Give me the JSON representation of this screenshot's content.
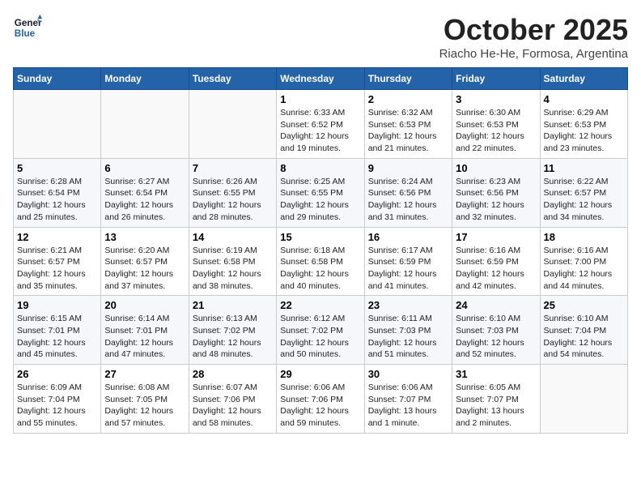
{
  "header": {
    "logo_general": "General",
    "logo_blue": "Blue",
    "month_title": "October 2025",
    "location": "Riacho He-He, Formosa, Argentina"
  },
  "weekdays": [
    "Sunday",
    "Monday",
    "Tuesday",
    "Wednesday",
    "Thursday",
    "Friday",
    "Saturday"
  ],
  "weeks": [
    [
      {
        "day": "",
        "info": ""
      },
      {
        "day": "",
        "info": ""
      },
      {
        "day": "",
        "info": ""
      },
      {
        "day": "1",
        "info": "Sunrise: 6:33 AM\nSunset: 6:52 PM\nDaylight: 12 hours\nand 19 minutes."
      },
      {
        "day": "2",
        "info": "Sunrise: 6:32 AM\nSunset: 6:53 PM\nDaylight: 12 hours\nand 21 minutes."
      },
      {
        "day": "3",
        "info": "Sunrise: 6:30 AM\nSunset: 6:53 PM\nDaylight: 12 hours\nand 22 minutes."
      },
      {
        "day": "4",
        "info": "Sunrise: 6:29 AM\nSunset: 6:53 PM\nDaylight: 12 hours\nand 23 minutes."
      }
    ],
    [
      {
        "day": "5",
        "info": "Sunrise: 6:28 AM\nSunset: 6:54 PM\nDaylight: 12 hours\nand 25 minutes."
      },
      {
        "day": "6",
        "info": "Sunrise: 6:27 AM\nSunset: 6:54 PM\nDaylight: 12 hours\nand 26 minutes."
      },
      {
        "day": "7",
        "info": "Sunrise: 6:26 AM\nSunset: 6:55 PM\nDaylight: 12 hours\nand 28 minutes."
      },
      {
        "day": "8",
        "info": "Sunrise: 6:25 AM\nSunset: 6:55 PM\nDaylight: 12 hours\nand 29 minutes."
      },
      {
        "day": "9",
        "info": "Sunrise: 6:24 AM\nSunset: 6:56 PM\nDaylight: 12 hours\nand 31 minutes."
      },
      {
        "day": "10",
        "info": "Sunrise: 6:23 AM\nSunset: 6:56 PM\nDaylight: 12 hours\nand 32 minutes."
      },
      {
        "day": "11",
        "info": "Sunrise: 6:22 AM\nSunset: 6:57 PM\nDaylight: 12 hours\nand 34 minutes."
      }
    ],
    [
      {
        "day": "12",
        "info": "Sunrise: 6:21 AM\nSunset: 6:57 PM\nDaylight: 12 hours\nand 35 minutes."
      },
      {
        "day": "13",
        "info": "Sunrise: 6:20 AM\nSunset: 6:57 PM\nDaylight: 12 hours\nand 37 minutes."
      },
      {
        "day": "14",
        "info": "Sunrise: 6:19 AM\nSunset: 6:58 PM\nDaylight: 12 hours\nand 38 minutes."
      },
      {
        "day": "15",
        "info": "Sunrise: 6:18 AM\nSunset: 6:58 PM\nDaylight: 12 hours\nand 40 minutes."
      },
      {
        "day": "16",
        "info": "Sunrise: 6:17 AM\nSunset: 6:59 PM\nDaylight: 12 hours\nand 41 minutes."
      },
      {
        "day": "17",
        "info": "Sunrise: 6:16 AM\nSunset: 6:59 PM\nDaylight: 12 hours\nand 42 minutes."
      },
      {
        "day": "18",
        "info": "Sunrise: 6:16 AM\nSunset: 7:00 PM\nDaylight: 12 hours\nand 44 minutes."
      }
    ],
    [
      {
        "day": "19",
        "info": "Sunrise: 6:15 AM\nSunset: 7:01 PM\nDaylight: 12 hours\nand 45 minutes."
      },
      {
        "day": "20",
        "info": "Sunrise: 6:14 AM\nSunset: 7:01 PM\nDaylight: 12 hours\nand 47 minutes."
      },
      {
        "day": "21",
        "info": "Sunrise: 6:13 AM\nSunset: 7:02 PM\nDaylight: 12 hours\nand 48 minutes."
      },
      {
        "day": "22",
        "info": "Sunrise: 6:12 AM\nSunset: 7:02 PM\nDaylight: 12 hours\nand 50 minutes."
      },
      {
        "day": "23",
        "info": "Sunrise: 6:11 AM\nSunset: 7:03 PM\nDaylight: 12 hours\nand 51 minutes."
      },
      {
        "day": "24",
        "info": "Sunrise: 6:10 AM\nSunset: 7:03 PM\nDaylight: 12 hours\nand 52 minutes."
      },
      {
        "day": "25",
        "info": "Sunrise: 6:10 AM\nSunset: 7:04 PM\nDaylight: 12 hours\nand 54 minutes."
      }
    ],
    [
      {
        "day": "26",
        "info": "Sunrise: 6:09 AM\nSunset: 7:04 PM\nDaylight: 12 hours\nand 55 minutes."
      },
      {
        "day": "27",
        "info": "Sunrise: 6:08 AM\nSunset: 7:05 PM\nDaylight: 12 hours\nand 57 minutes."
      },
      {
        "day": "28",
        "info": "Sunrise: 6:07 AM\nSunset: 7:06 PM\nDaylight: 12 hours\nand 58 minutes."
      },
      {
        "day": "29",
        "info": "Sunrise: 6:06 AM\nSunset: 7:06 PM\nDaylight: 12 hours\nand 59 minutes."
      },
      {
        "day": "30",
        "info": "Sunrise: 6:06 AM\nSunset: 7:07 PM\nDaylight: 13 hours\nand 1 minute."
      },
      {
        "day": "31",
        "info": "Sunrise: 6:05 AM\nSunset: 7:07 PM\nDaylight: 13 hours\nand 2 minutes."
      },
      {
        "day": "",
        "info": ""
      }
    ]
  ]
}
